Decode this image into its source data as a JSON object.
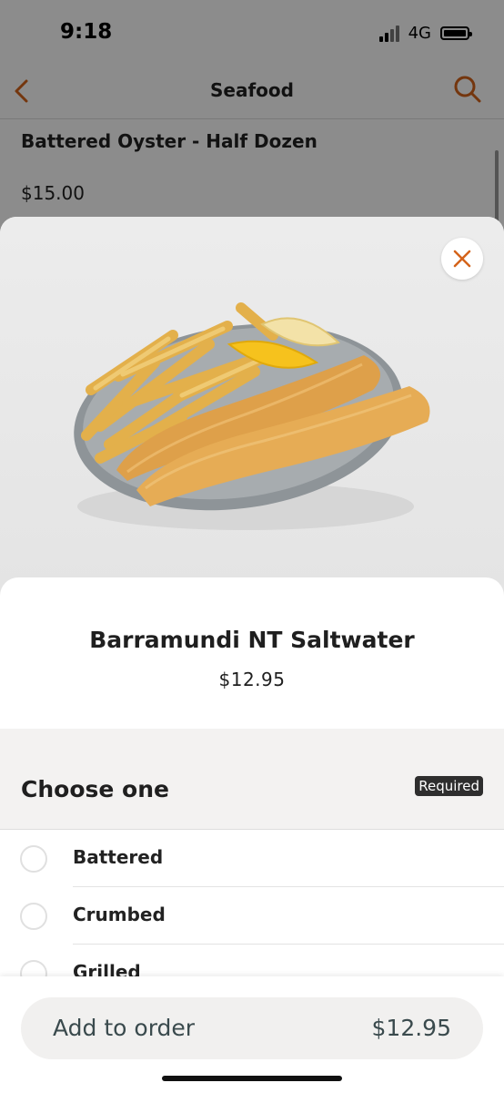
{
  "status": {
    "time": "9:18",
    "network": "4G"
  },
  "nav": {
    "title": "Seafood"
  },
  "background_item": {
    "name": "Battered Oyster - Half Dozen",
    "price": "$15.00"
  },
  "item": {
    "title": "Barramundi NT Saltwater",
    "price": "$12.95"
  },
  "options": {
    "heading": "Choose one",
    "badge": "Required",
    "items": [
      {
        "label": "Battered"
      },
      {
        "label": "Crumbed"
      },
      {
        "label": "Grilled"
      }
    ]
  },
  "order": {
    "label": "Add to order",
    "price": "$12.95"
  },
  "colors": {
    "accent": "#d4631a",
    "badge": "#2e2e2e"
  }
}
